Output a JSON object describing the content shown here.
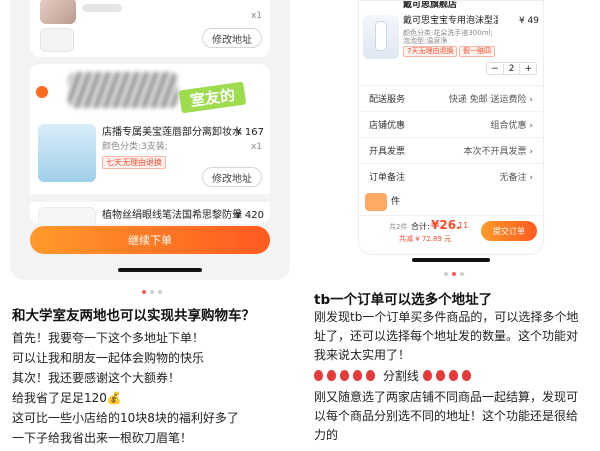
{
  "left": {
    "card1": {
      "qty": "x1",
      "edit_button": "修改地址"
    },
    "card2": {
      "sticker_text": "室友的",
      "item1": {
        "title": "店播专属美宝莲唇部分离卸妆水",
        "price": "¥ 167",
        "spec": "颜色分类:3支装;",
        "qty": "x1",
        "tag": "七天无理由退换"
      },
      "edit_button": "修改地址",
      "item2": {
        "title": "植物丝绢眼线笔法国希思黎防晕",
        "price": "¥ 420"
      }
    },
    "checkout_button": "继续下单",
    "caption": {
      "title": "和大学室友两地也可以实现共享购物车？",
      "lines": [
        "首先！我要夸一下这个多地址下单！",
        "可以让我和朋友一起体会购物的快乐",
        "其次！我还要感谢这个大额券！",
        "给我省了足足120💰",
        "这可比一些小店给的10块8块的福利好多了",
        "一下子给我省出来一根砍刀眉笔！"
      ]
    }
  },
  "right": {
    "shop_name": "戴可思旗舰店",
    "product": {
      "title": "戴可思宝宝专用泡沫型温和洗",
      "price": "¥ 49",
      "spec": "颜色分类:花朵洗手液300ml;",
      "spec2": "泡泡型;温泉净",
      "tag": "7天无理由退换",
      "tag2": "假一赔四",
      "stepper_minus": "−",
      "stepper_value": "2",
      "stepper_plus": "+"
    },
    "rows": [
      {
        "label": "配送服务",
        "value": "快递 免邮 送运费险 ›"
      },
      {
        "label": "店铺优惠",
        "value": "组合优惠 ›"
      },
      {
        "label": "开具发票",
        "value": "本次不开具发票 ›"
      },
      {
        "label": "订单备注",
        "value": "无备注 ›"
      }
    ],
    "partial_label": "件",
    "footer": {
      "count": "共2件",
      "total_label": "合计:",
      "total": "¥26.",
      "total_small": "11",
      "discount": "共减 ¥ 72.89 元",
      "submit": "提交订单"
    },
    "caption": {
      "title": "tb一个订单可以选多个地址了",
      "para1": "刚发现tb一个订单买多件商品的，可以选择多个地址了，还可以选择每个地址发的数量。这个功能对我来说太实用了！",
      "divider": "分割线",
      "para2": "刚又随意选了两家店铺不同商品一起结算，发现可以每个商品分别选不同的地址！这个功能还是很给力的"
    }
  },
  "colors": {
    "accent": "#ff6a1f",
    "price_red": "#ff4a2a",
    "sticker_green": "#8fd14a"
  }
}
